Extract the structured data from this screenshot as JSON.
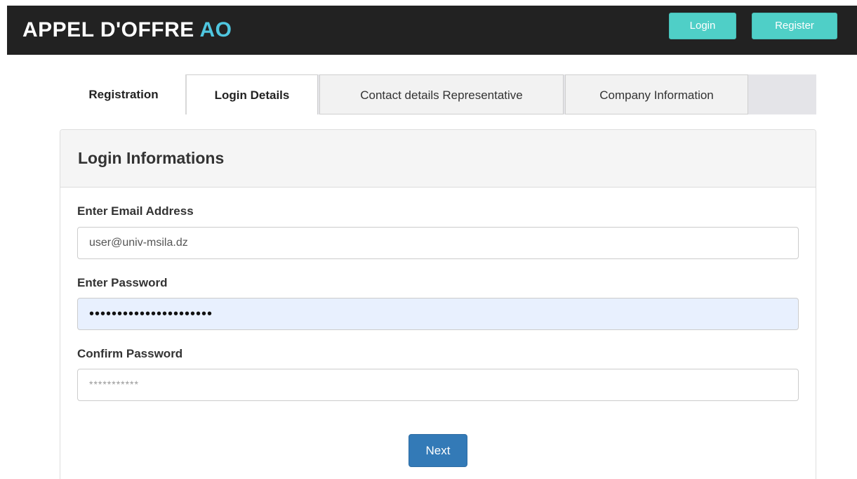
{
  "navbar": {
    "brand_main": "APPEL D'OFFRE ",
    "brand_accent": "AO",
    "login_label": "Login",
    "register_label": "Register"
  },
  "tabs": [
    {
      "label": "Registration"
    },
    {
      "label": "Login Details"
    },
    {
      "label": "Contact details Representative"
    },
    {
      "label": "Company Information"
    }
  ],
  "panel": {
    "title": "Login Informations",
    "email": {
      "label": "Enter Email Address",
      "value": "user@univ-msila.dz"
    },
    "password": {
      "label": "Enter Password",
      "value": "••••••••••••••••••••••"
    },
    "confirm_password": {
      "label": "Confirm Password",
      "placeholder": "***********"
    },
    "next_label": "Next"
  },
  "colors": {
    "navbar_bg": "#222222",
    "brand_accent": "#4fc6df",
    "nav_button": "#4fcfc7",
    "primary_button": "#337ab7",
    "autofill_bg": "#e8f0fe"
  }
}
